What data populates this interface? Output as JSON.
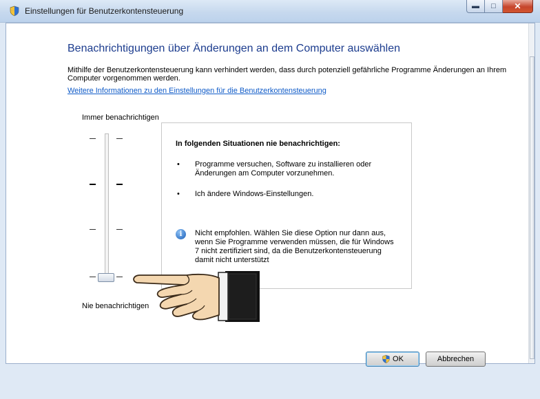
{
  "window": {
    "title": "Einstellungen für Benutzerkontensteuerung",
    "icon": "uac-shield-icon",
    "controls": [
      "minimize-icon",
      "maximize-icon",
      "close-icon"
    ]
  },
  "main": {
    "heading": "Benachrichtigungen über Änderungen an dem Computer auswählen",
    "description": "Mithilfe der Benutzerkontensteuerung kann verhindert werden, dass durch potenziell gefährliche Programme Änderungen an Ihrem Computer vorgenommen werden.",
    "link": "Weitere Informationen zu den Einstellungen für die Benutzerkontensteuerung"
  },
  "slider": {
    "top_label": "Immer benachrichtigen",
    "bottom_label": "Nie benachrichtigen",
    "levels": 4,
    "selected_level": 1
  },
  "info_panel": {
    "title": "In folgenden Situationen nie benachrichtigen:",
    "bullets": [
      "Programme versuchen, Software zu installieren oder Änderungen am Computer vorzunehmen.",
      "Ich ändere Windows-Einstellungen."
    ],
    "bullet_glyph": "•",
    "note_icon": "info-icon",
    "note": "Nicht empfohlen. Wählen Sie diese Option nur dann aus, wenn Sie Programme verwenden müssen, die für Windows 7 nicht zertifiziert sind, da die Benutzerkontensteuerung damit nicht unterstützt"
  },
  "buttons": {
    "ok": "OK",
    "cancel": "Abbrechen"
  },
  "colors": {
    "heading": "#1c3c8e",
    "link": "#0f5bc8"
  }
}
